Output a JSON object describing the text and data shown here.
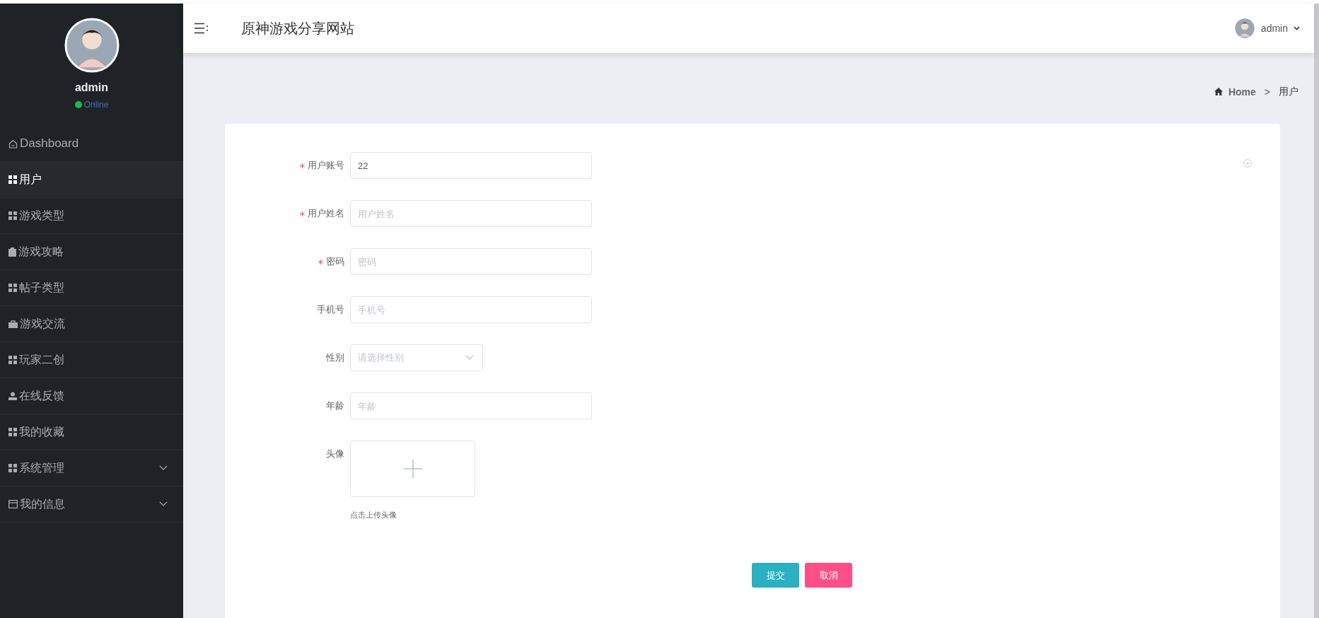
{
  "header": {
    "title": "原神游戏分享网站",
    "user": "admin"
  },
  "sidebar": {
    "user": "admin",
    "status": "Online",
    "items": [
      {
        "label": "Dashboard",
        "kind": "link",
        "selected": false
      },
      {
        "label": "用户",
        "kind": "link",
        "selected": true
      },
      {
        "label": "游戏类型",
        "kind": "link",
        "selected": false
      },
      {
        "label": "游戏攻略",
        "kind": "link",
        "selected": false
      },
      {
        "label": "帖子类型",
        "kind": "link",
        "selected": false
      },
      {
        "label": "游戏交流",
        "kind": "link",
        "selected": false
      },
      {
        "label": "玩家二创",
        "kind": "link",
        "selected": false
      },
      {
        "label": "在线反馈",
        "kind": "link",
        "selected": false
      },
      {
        "label": "我的收藏",
        "kind": "link",
        "selected": false
      },
      {
        "label": "系统管理",
        "kind": "group",
        "selected": false,
        "expanded": false
      },
      {
        "label": "我的信息",
        "kind": "group",
        "selected": false,
        "expanded": false
      }
    ]
  },
  "breadcrumb": {
    "items": [
      "Home",
      "用户"
    ],
    "separator": ">"
  },
  "form": {
    "fields": [
      {
        "label": "用户账号",
        "kind": "text",
        "required": true,
        "value": "22"
      },
      {
        "label": "用户姓名",
        "kind": "text",
        "required": true,
        "placeholder": "用户姓名"
      },
      {
        "label": "密码",
        "kind": "text",
        "required": true,
        "placeholder": "密码"
      },
      {
        "label": "手机号",
        "kind": "text",
        "required": false,
        "placeholder": "手机号"
      },
      {
        "label": "性别",
        "kind": "select",
        "required": false,
        "placeholder": "请选择性别"
      },
      {
        "label": "年龄",
        "kind": "text",
        "required": false,
        "placeholder": "年龄"
      },
      {
        "label": "头像",
        "kind": "upload",
        "required": false,
        "hint": "点击上传头像"
      }
    ],
    "buttons": [
      {
        "label": "提交",
        "kind": "primary"
      },
      {
        "label": "取消",
        "kind": "danger"
      }
    ]
  }
}
